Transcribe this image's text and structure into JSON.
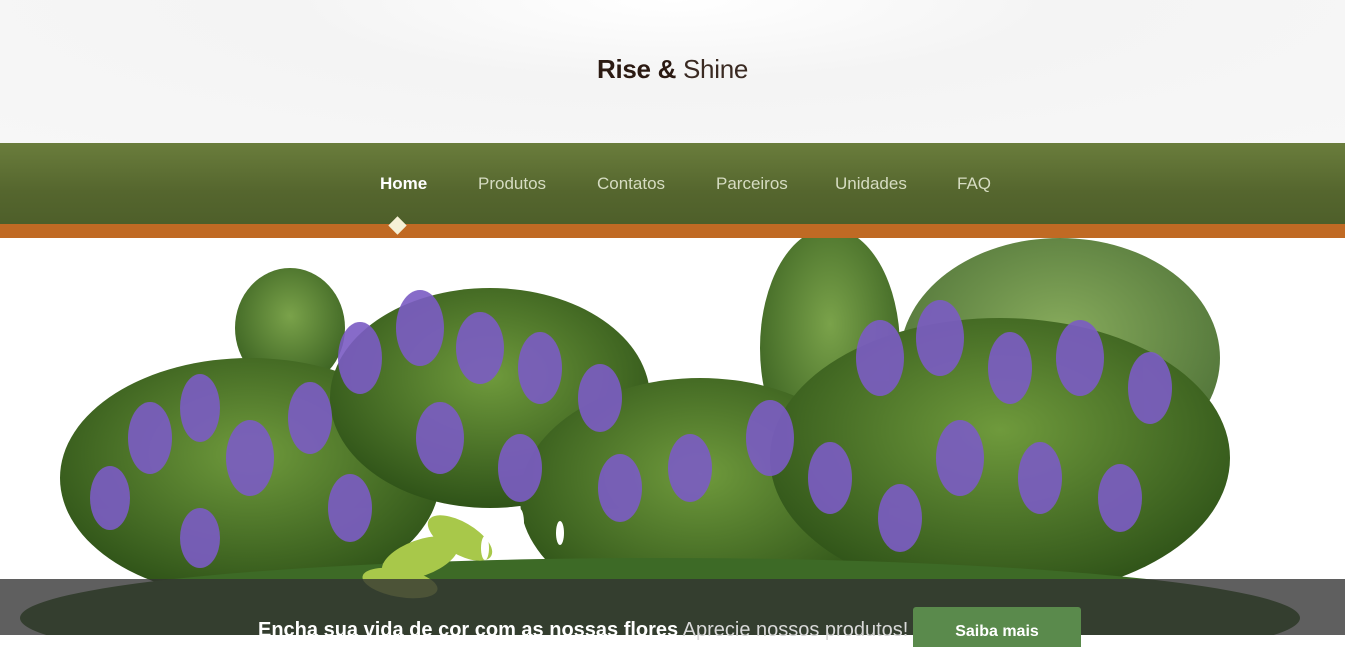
{
  "brand": {
    "bold": "Rise &",
    "light": " Shine"
  },
  "nav": {
    "items": [
      {
        "label": "Home",
        "active": true
      },
      {
        "label": "Produtos",
        "active": false
      },
      {
        "label": "Contatos",
        "active": false
      },
      {
        "label": "Parceiros",
        "active": false
      },
      {
        "label": "Unidades",
        "active": false
      },
      {
        "label": "FAQ",
        "active": false
      }
    ]
  },
  "banner": {
    "headline": "Encha sua vida de cor com as nossas flores",
    "subline": "Aprecie nossos produtos!",
    "cta_label": "Saiba mais"
  },
  "colors": {
    "nav": "#55662e",
    "accent_stripe": "#c06a24",
    "cta": "#5a8a4c",
    "flower": "#7b5cc4"
  }
}
